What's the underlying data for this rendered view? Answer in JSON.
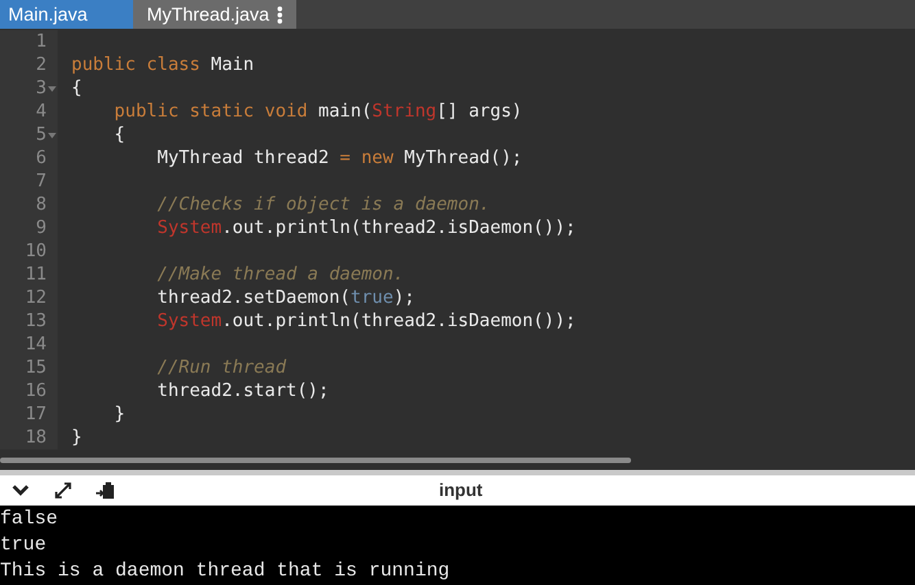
{
  "tabs": [
    {
      "label": "Main.java",
      "selected": true
    },
    {
      "label": "MyThread.java",
      "selected": false
    }
  ],
  "editor": {
    "lines": [
      {
        "number": "1"
      },
      {
        "number": "2",
        "tokens": [
          {
            "kind": "keyword",
            "text": "public class "
          },
          {
            "kind": "plain",
            "text": "Main"
          }
        ]
      },
      {
        "number": "3",
        "foldable": true,
        "tokens": [
          {
            "kind": "plain",
            "text": "{"
          }
        ]
      },
      {
        "number": "4",
        "tokens": [
          {
            "kind": "keyword",
            "text": "    public static void "
          },
          {
            "kind": "plain",
            "text": "main("
          },
          {
            "kind": "type",
            "text": "String"
          },
          {
            "kind": "plain",
            "text": "[] args)"
          }
        ]
      },
      {
        "number": "5",
        "foldable": true,
        "tokens": [
          {
            "kind": "plain",
            "text": "    {"
          }
        ]
      },
      {
        "number": "6",
        "tokens": [
          {
            "kind": "plain",
            "text": "        MyThread thread2 "
          },
          {
            "kind": "keyword",
            "text": "= new"
          },
          {
            "kind": "plain",
            "text": " MyThread();"
          }
        ]
      },
      {
        "number": "7"
      },
      {
        "number": "8",
        "tokens": [
          {
            "kind": "comment",
            "text": "        //Checks if object is a daemon."
          }
        ]
      },
      {
        "number": "9",
        "tokens": [
          {
            "kind": "type",
            "text": "        System"
          },
          {
            "kind": "plain",
            "text": ".out.println(thread2.isDaemon());"
          }
        ]
      },
      {
        "number": "10"
      },
      {
        "number": "11",
        "tokens": [
          {
            "kind": "comment",
            "text": "        //Make thread a daemon."
          }
        ]
      },
      {
        "number": "12",
        "tokens": [
          {
            "kind": "plain",
            "text": "        thread2.setDaemon("
          },
          {
            "kind": "literal",
            "text": "true"
          },
          {
            "kind": "plain",
            "text": ");"
          }
        ]
      },
      {
        "number": "13",
        "tokens": [
          {
            "kind": "type",
            "text": "        System"
          },
          {
            "kind": "plain",
            "text": ".out.println(thread2.isDaemon());"
          }
        ]
      },
      {
        "number": "14"
      },
      {
        "number": "15",
        "tokens": [
          {
            "kind": "comment",
            "text": "        //Run thread"
          }
        ]
      },
      {
        "number": "16",
        "tokens": [
          {
            "kind": "plain",
            "text": "        thread2.start();"
          }
        ]
      },
      {
        "number": "17",
        "tokens": [
          {
            "kind": "plain",
            "text": "    }"
          }
        ]
      },
      {
        "number": "18",
        "tokens": [
          {
            "kind": "plain",
            "text": "}"
          }
        ]
      }
    ]
  },
  "console": {
    "title": "input",
    "output": [
      "false",
      "true",
      "This is a daemon thread that is running"
    ]
  }
}
